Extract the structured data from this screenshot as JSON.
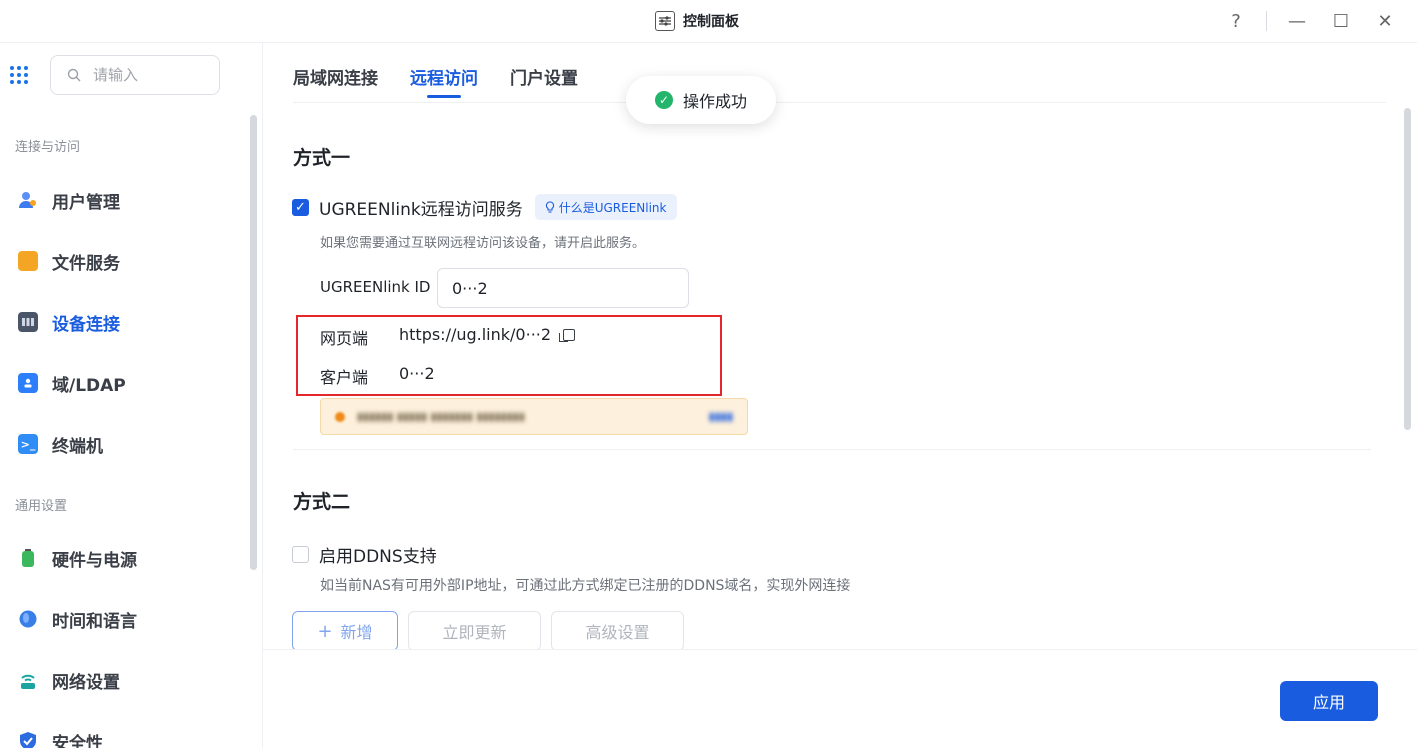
{
  "window": {
    "title": "控制面板",
    "help": "?",
    "minimize": "—",
    "maximize": "☐",
    "close": "✕"
  },
  "sidebar": {
    "search_placeholder": "请输入",
    "groups": [
      {
        "label": "连接与访问",
        "items": [
          {
            "label": "用户管理",
            "icon": "users-icon",
            "color": "#3d7bf0"
          },
          {
            "label": "文件服务",
            "icon": "folder-icon",
            "color": "#f5a524"
          },
          {
            "label": "设备连接",
            "icon": "device-icon",
            "color": "#4a5568",
            "active": true
          },
          {
            "label": "域/LDAP",
            "icon": "ldap-icon",
            "color": "#2d7ff9"
          },
          {
            "label": "终端机",
            "icon": "terminal-icon",
            "color": "#2f8df5"
          }
        ]
      },
      {
        "label": "通用设置",
        "items": [
          {
            "label": "硬件与电源",
            "icon": "battery-icon",
            "color": "#3bb75e"
          },
          {
            "label": "时间和语言",
            "icon": "globe-icon",
            "color": "#3a7fe8"
          },
          {
            "label": "网络设置",
            "icon": "router-icon",
            "color": "#1aa5a0"
          },
          {
            "label": "安全性",
            "icon": "shield-icon",
            "color": "#2d6be0"
          }
        ]
      }
    ]
  },
  "tabs": [
    "局域网连接",
    "远程访问",
    "门户设置"
  ],
  "active_tab": "远程访问",
  "toast": "操作成功",
  "method1": {
    "title": "方式一",
    "checkbox_label": "UGREENlink远程访问服务",
    "checked": true,
    "help_link": "什么是UGREENlink",
    "desc": "如果您需要通过互联网远程访问该设备，请开启此服务。",
    "id_label": "UGREENlink ID",
    "id_value": "0···2",
    "web_label": "网页端",
    "web_value": "https://ug.link/0···2",
    "client_label": "客户端",
    "client_value": "0···2"
  },
  "method2": {
    "title": "方式二",
    "checkbox_label": "启用DDNS支持",
    "checked": false,
    "desc": "如当前NAS有可用外部IP地址，可通过此方式绑定已注册的DDNS域名，实现外网连接",
    "buttons": [
      "新增",
      "立即更新",
      "高级设置"
    ]
  },
  "footer": {
    "apply": "应用"
  },
  "colors": {
    "accent": "#1a5ce0",
    "success": "#22b56b",
    "highlight_box": "#e5262b"
  }
}
